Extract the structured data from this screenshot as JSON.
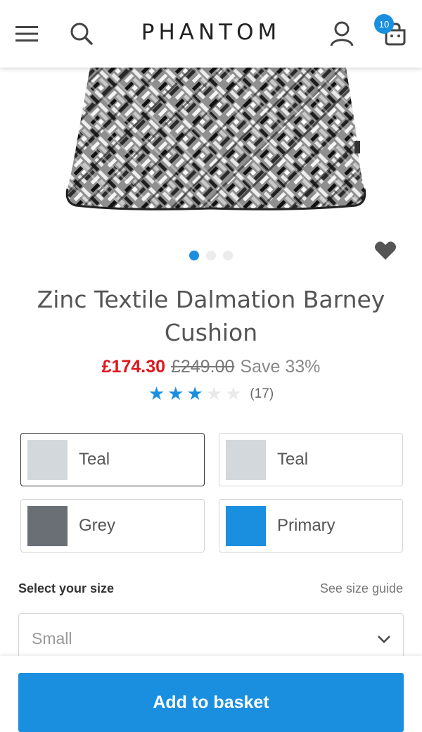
{
  "header": {
    "logo": "PHANTOM",
    "basket_count": "10"
  },
  "product": {
    "title": "Zinc Textile Dalmation Barney Cushion",
    "price_now": "£174.30",
    "price_was": "£249.00",
    "save_text": "Save 33%",
    "rating": 3,
    "rating_max": 5,
    "review_count": "(17)",
    "image_dots": 3,
    "active_dot": 0
  },
  "colors": {
    "accent": "#1a8fe0",
    "sale_red": "#e0161e"
  },
  "swatches": [
    {
      "label": "Teal",
      "color": "#d3d8dc",
      "selected": true
    },
    {
      "label": "Teal",
      "color": "#d3d8dc",
      "selected": false
    },
    {
      "label": "Grey",
      "color": "#6a6e75",
      "selected": false
    },
    {
      "label": "Primary",
      "color": "#1a8fe0",
      "selected": false
    }
  ],
  "size": {
    "label": "Select your size",
    "guide_link": "See size guide",
    "selected_value": "Small"
  },
  "cta": {
    "label": "Add to basket"
  }
}
